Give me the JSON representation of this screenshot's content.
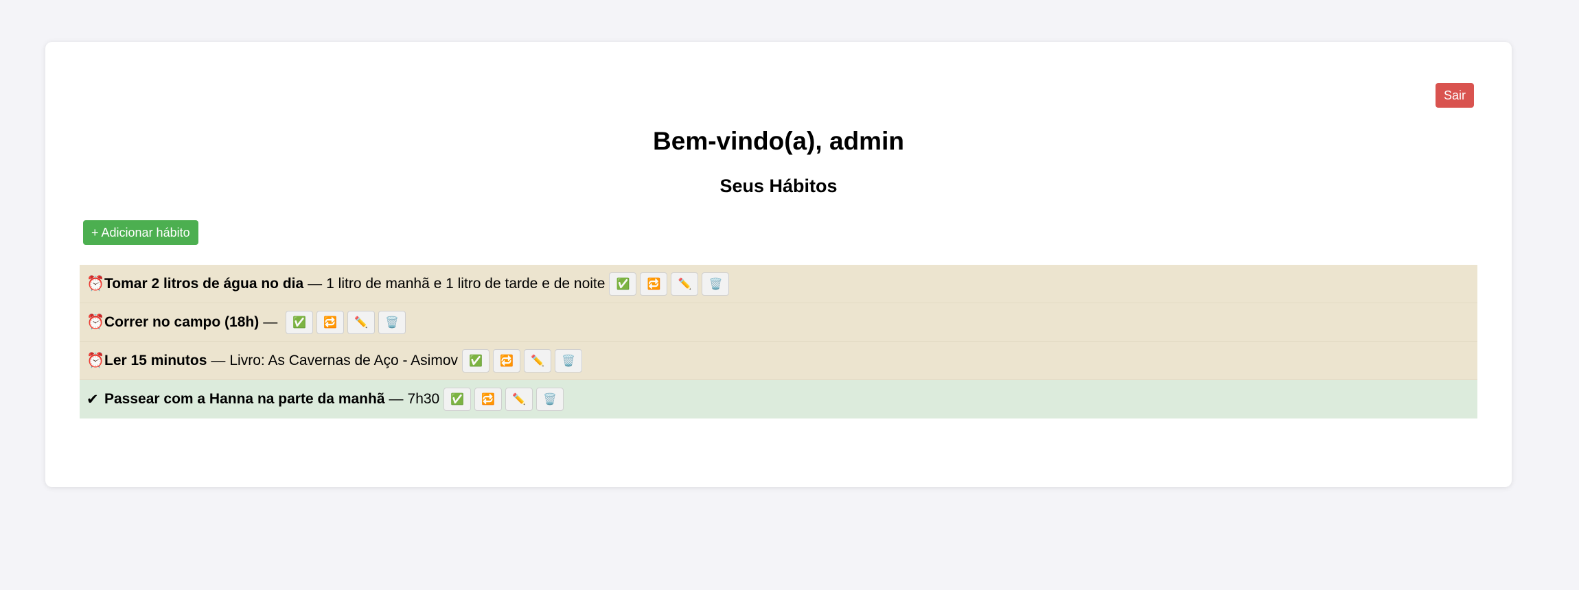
{
  "header": {
    "logout_label": "Sair",
    "title": "Bem-vindo(a), admin",
    "subtitle": "Seus Hábitos"
  },
  "toolbar": {
    "add_label": "+ Adicionar hábito"
  },
  "icons": {
    "pending": "⏰",
    "done": "✔",
    "separator": "—",
    "complete": "✅",
    "repeat": "🔁",
    "edit": "✏️",
    "delete": "🗑️"
  },
  "habits": [
    {
      "name": "Tomar 2 litros de água no dia",
      "description": "1 litro de manhã e 1 litro de tarde e de noite",
      "status": "pending"
    },
    {
      "name": "Correr no campo (18h)",
      "description": "",
      "status": "pending"
    },
    {
      "name": "Ler 15 minutos",
      "description": "Livro: As Cavernas de Aço - Asimov",
      "status": "pending"
    },
    {
      "name": "Passear com a Hanna na parte da manhã",
      "description": "7h30",
      "status": "done"
    }
  ],
  "colors": {
    "pending_row": "#ece4cf",
    "done_row": "#dcebdc",
    "logout_button": "#d9534f",
    "add_button": "#4caf50"
  }
}
